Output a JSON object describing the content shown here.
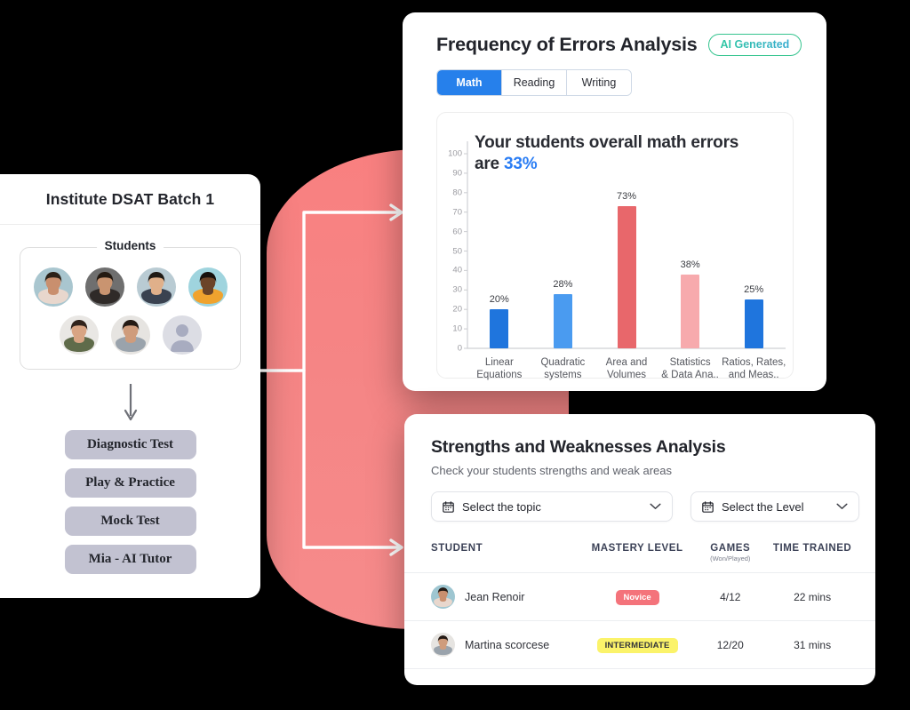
{
  "background_color": "#000000",
  "accent": {
    "blue": "#2680eb",
    "red": "#e8676b",
    "pink": "#f7aaad",
    "blob": "#f98080",
    "yellow": "#fbf36a"
  },
  "left_panel": {
    "title": "Institute DSAT Batch 1",
    "students_legend": "Students",
    "avatars": [
      {
        "name": "student-avatar-1",
        "bg": "#a9c6cf",
        "skin": "#c98f6e",
        "hair": "#2b2118",
        "top": "#e8d7cd"
      },
      {
        "name": "student-avatar-2",
        "bg": "#6f6f6f",
        "skin": "#c99470",
        "hair": "#241a12",
        "top": "#2f2a28"
      },
      {
        "name": "student-avatar-3",
        "bg": "#b9cbd3",
        "skin": "#e0b08a",
        "hair": "#1f1a15",
        "top": "#3a4250"
      },
      {
        "name": "student-avatar-4",
        "bg": "#9fd4de",
        "skin": "#6b4428",
        "hair": "#15100c",
        "top": "#f0a32e"
      },
      {
        "name": "student-avatar-5",
        "bg": "#e9e7e4",
        "skin": "#d8a483",
        "hair": "#30231b",
        "top": "#5f6b4a"
      },
      {
        "name": "student-avatar-6",
        "bg": "#e6e4e1",
        "skin": "#cf9c7c",
        "hair": "#241a14",
        "top": "#9aa3ac"
      },
      {
        "name": "student-avatar-placeholder",
        "bg": "#dcdde4",
        "skin": "#a8acc0",
        "hair": "#a8acc0",
        "top": "#a8acc0"
      }
    ],
    "avatar_rows": [
      4,
      3
    ],
    "actions": [
      "Diagnostic Test",
      "Play & Practice",
      "Mock Test",
      "Mia - AI Tutor"
    ]
  },
  "chart_card": {
    "title": "Frequency of Errors Analysis",
    "ai_badge": "AI Generated",
    "tabs": [
      {
        "label": "Math",
        "active": true
      },
      {
        "label": "Reading",
        "active": false
      },
      {
        "label": "Writing",
        "active": false
      }
    ],
    "summary_prefix": "Your students overall math errors are ",
    "summary_value": "33%"
  },
  "chart_data": {
    "type": "bar",
    "title": "Your students overall math errors are 33%",
    "xlabel": "",
    "ylabel": "",
    "ylim": [
      0,
      100
    ],
    "yticks": [
      0,
      10,
      20,
      30,
      40,
      50,
      60,
      70,
      80,
      90,
      100
    ],
    "grid": false,
    "legend": "none",
    "categories": [
      "Linear\nEquations",
      "Quadratic\nsystems",
      "Area and\nVolumes",
      "Statistics\n& Data Ana..",
      "Ratios, Rates,\nand Meas.."
    ],
    "values": [
      20,
      28,
      73,
      38,
      25
    ],
    "data_labels": [
      "20%",
      "28%",
      "73%",
      "38%",
      "25%"
    ],
    "colors": [
      "#1f75dd",
      "#4a9bf0",
      "#e8676b",
      "#f7aaad",
      "#1f75dd"
    ]
  },
  "strengths_card": {
    "title": "Strengths and Weaknesses Analysis",
    "subtitle": "Check your students strengths and weak areas",
    "selects": [
      {
        "name": "topic",
        "value": "Select the topic"
      },
      {
        "name": "level",
        "value": "Select the Level"
      }
    ],
    "table": {
      "headers": [
        {
          "label": "STUDENT",
          "sub": ""
        },
        {
          "label": "MASTERY LEVEL",
          "sub": ""
        },
        {
          "label": "GAMES",
          "sub": "(Won/Played)"
        },
        {
          "label": "TIME TRAINED",
          "sub": ""
        }
      ],
      "rows": [
        {
          "student": "Jean Renoir",
          "mastery": "Novice",
          "mastery_style": "novice",
          "games": "4/12",
          "time": "22 mins",
          "avatar": {
            "bg": "#9ec6d1",
            "skin": "#c98f6e",
            "hair": "#241a14",
            "top": "#e8d7cd"
          }
        },
        {
          "student": "Martina scorcese",
          "mastery": "INTERMEDIATE",
          "mastery_style": "inter",
          "games": "12/20",
          "time": "31 mins",
          "avatar": {
            "bg": "#e6e4e1",
            "skin": "#cf9c7c",
            "hair": "#241a14",
            "top": "#9aa3ac"
          }
        }
      ]
    }
  }
}
